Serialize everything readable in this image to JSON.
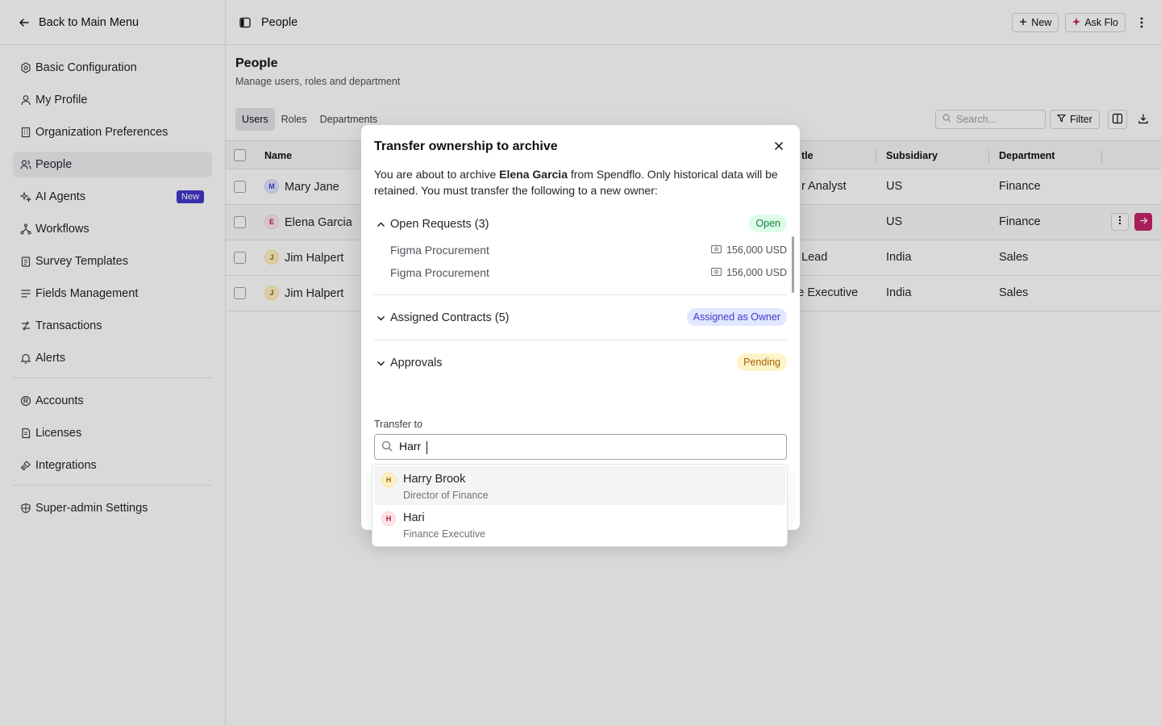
{
  "sidebar": {
    "back_label": "Back to Main Menu",
    "items": [
      {
        "label": "Basic Configuration",
        "icon": "settings-hex-icon"
      },
      {
        "label": "My Profile",
        "icon": "user-icon"
      },
      {
        "label": "Organization Preferences",
        "icon": "building-icon"
      },
      {
        "label": "People",
        "icon": "users-icon",
        "active": true
      },
      {
        "label": "AI Agents",
        "icon": "sparkle-icon",
        "badge": "New"
      },
      {
        "label": "Workflows",
        "icon": "workflow-icon"
      },
      {
        "label": "Survey Templates",
        "icon": "clipboard-icon"
      },
      {
        "label": "Fields Management",
        "icon": "list-icon"
      },
      {
        "label": "Transactions",
        "icon": "transactions-icon"
      },
      {
        "label": "Alerts",
        "icon": "bell-icon"
      }
    ],
    "items2": [
      {
        "label": "Accounts",
        "icon": "account-icon"
      },
      {
        "label": "Licenses",
        "icon": "license-icon"
      },
      {
        "label": "Integrations",
        "icon": "integration-icon"
      }
    ],
    "items3": [
      {
        "label": "Super-admin Settings",
        "icon": "shield-icon"
      }
    ]
  },
  "header": {
    "breadcrumb": "People",
    "new_label": "New",
    "ask_label": "Ask Flo"
  },
  "page": {
    "title": "People",
    "subtitle": "Manage users, roles and department"
  },
  "tabs": [
    "Users",
    "Roles",
    "Departments"
  ],
  "toolbar": {
    "search_placeholder": "Search...",
    "filter_label": "Filter"
  },
  "table": {
    "columns": {
      "name": "Name",
      "title": "tle",
      "subsidiary": "Subsidiary",
      "department": "Department"
    },
    "rows": [
      {
        "initial": "M",
        "name": "Mary Jane",
        "title": "r Analyst",
        "subsidiary": "US",
        "department": "Finance"
      },
      {
        "initial": "E",
        "name": "Elena Garcia",
        "title": "",
        "subsidiary": "US",
        "department": "Finance"
      },
      {
        "initial": "J",
        "name": "Jim Halpert",
        "title": "Lead",
        "subsidiary": "India",
        "department": "Sales"
      },
      {
        "initial": "J",
        "name": "Jim Halpert",
        "title": "ce Executive",
        "subsidiary": "India",
        "department": "Sales"
      }
    ]
  },
  "modal": {
    "title": "Transfer ownership to archive",
    "desc_pre": "You are about to archive ",
    "desc_name": "Elena Garcia",
    "desc_post": " from Spendflo. Only historical data will be retained. You must transfer the following to a new owner:",
    "sections": {
      "open_requests": {
        "label": "Open Requests (3)",
        "status": "Open"
      },
      "contracts": {
        "label": "Assigned Contracts (5)",
        "status": "Assigned as Owner"
      },
      "approvals": {
        "label": "Approvals",
        "status": "Pending"
      }
    },
    "requests": [
      {
        "name": "Figma Procurement",
        "amount": "156,000 USD"
      },
      {
        "name": "Figma Procurement",
        "amount": "156,000 USD"
      }
    ],
    "transfer_label": "Transfer to",
    "transfer_value": "Harr "
  },
  "dropdown": {
    "options": [
      {
        "initial": "H",
        "name": "Harry Brook",
        "role": "Director of Finance"
      },
      {
        "initial": "H",
        "name": "Hari",
        "role": "Finance Executive"
      }
    ]
  },
  "colors": {
    "accent": "#4338ca",
    "brand_pink": "#c8246a",
    "open_green": "#15803d",
    "pending_amber": "#a16207"
  }
}
